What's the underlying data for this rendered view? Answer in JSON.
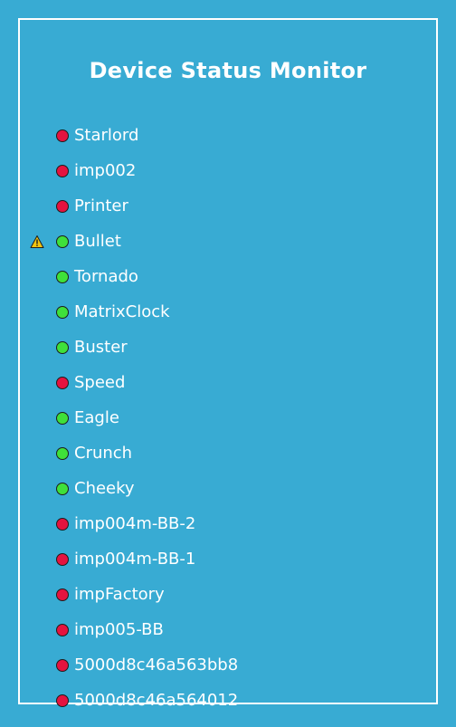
{
  "title": "Device Status Monitor",
  "colors": {
    "online": "#3fe03a",
    "offline": "#e5133f",
    "warning": "#f1c40f"
  },
  "devices": [
    {
      "name": "Starlord",
      "status": "offline",
      "warning": false
    },
    {
      "name": "imp002",
      "status": "offline",
      "warning": false
    },
    {
      "name": "Printer",
      "status": "offline",
      "warning": false
    },
    {
      "name": "Bullet",
      "status": "online",
      "warning": true
    },
    {
      "name": "Tornado",
      "status": "online",
      "warning": false
    },
    {
      "name": "MatrixClock",
      "status": "online",
      "warning": false
    },
    {
      "name": "Buster",
      "status": "online",
      "warning": false
    },
    {
      "name": "Speed",
      "status": "offline",
      "warning": false
    },
    {
      "name": "Eagle",
      "status": "online",
      "warning": false
    },
    {
      "name": "Crunch",
      "status": "online",
      "warning": false
    },
    {
      "name": "Cheeky",
      "status": "online",
      "warning": false
    },
    {
      "name": "imp004m-BB-2",
      "status": "offline",
      "warning": false
    },
    {
      "name": "imp004m-BB-1",
      "status": "offline",
      "warning": false
    },
    {
      "name": "impFactory",
      "status": "offline",
      "warning": false
    },
    {
      "name": "imp005-BB",
      "status": "offline",
      "warning": false
    },
    {
      "name": "5000d8c46a563bb8",
      "status": "offline",
      "warning": false
    },
    {
      "name": "5000d8c46a564012",
      "status": "offline",
      "warning": false
    }
  ]
}
